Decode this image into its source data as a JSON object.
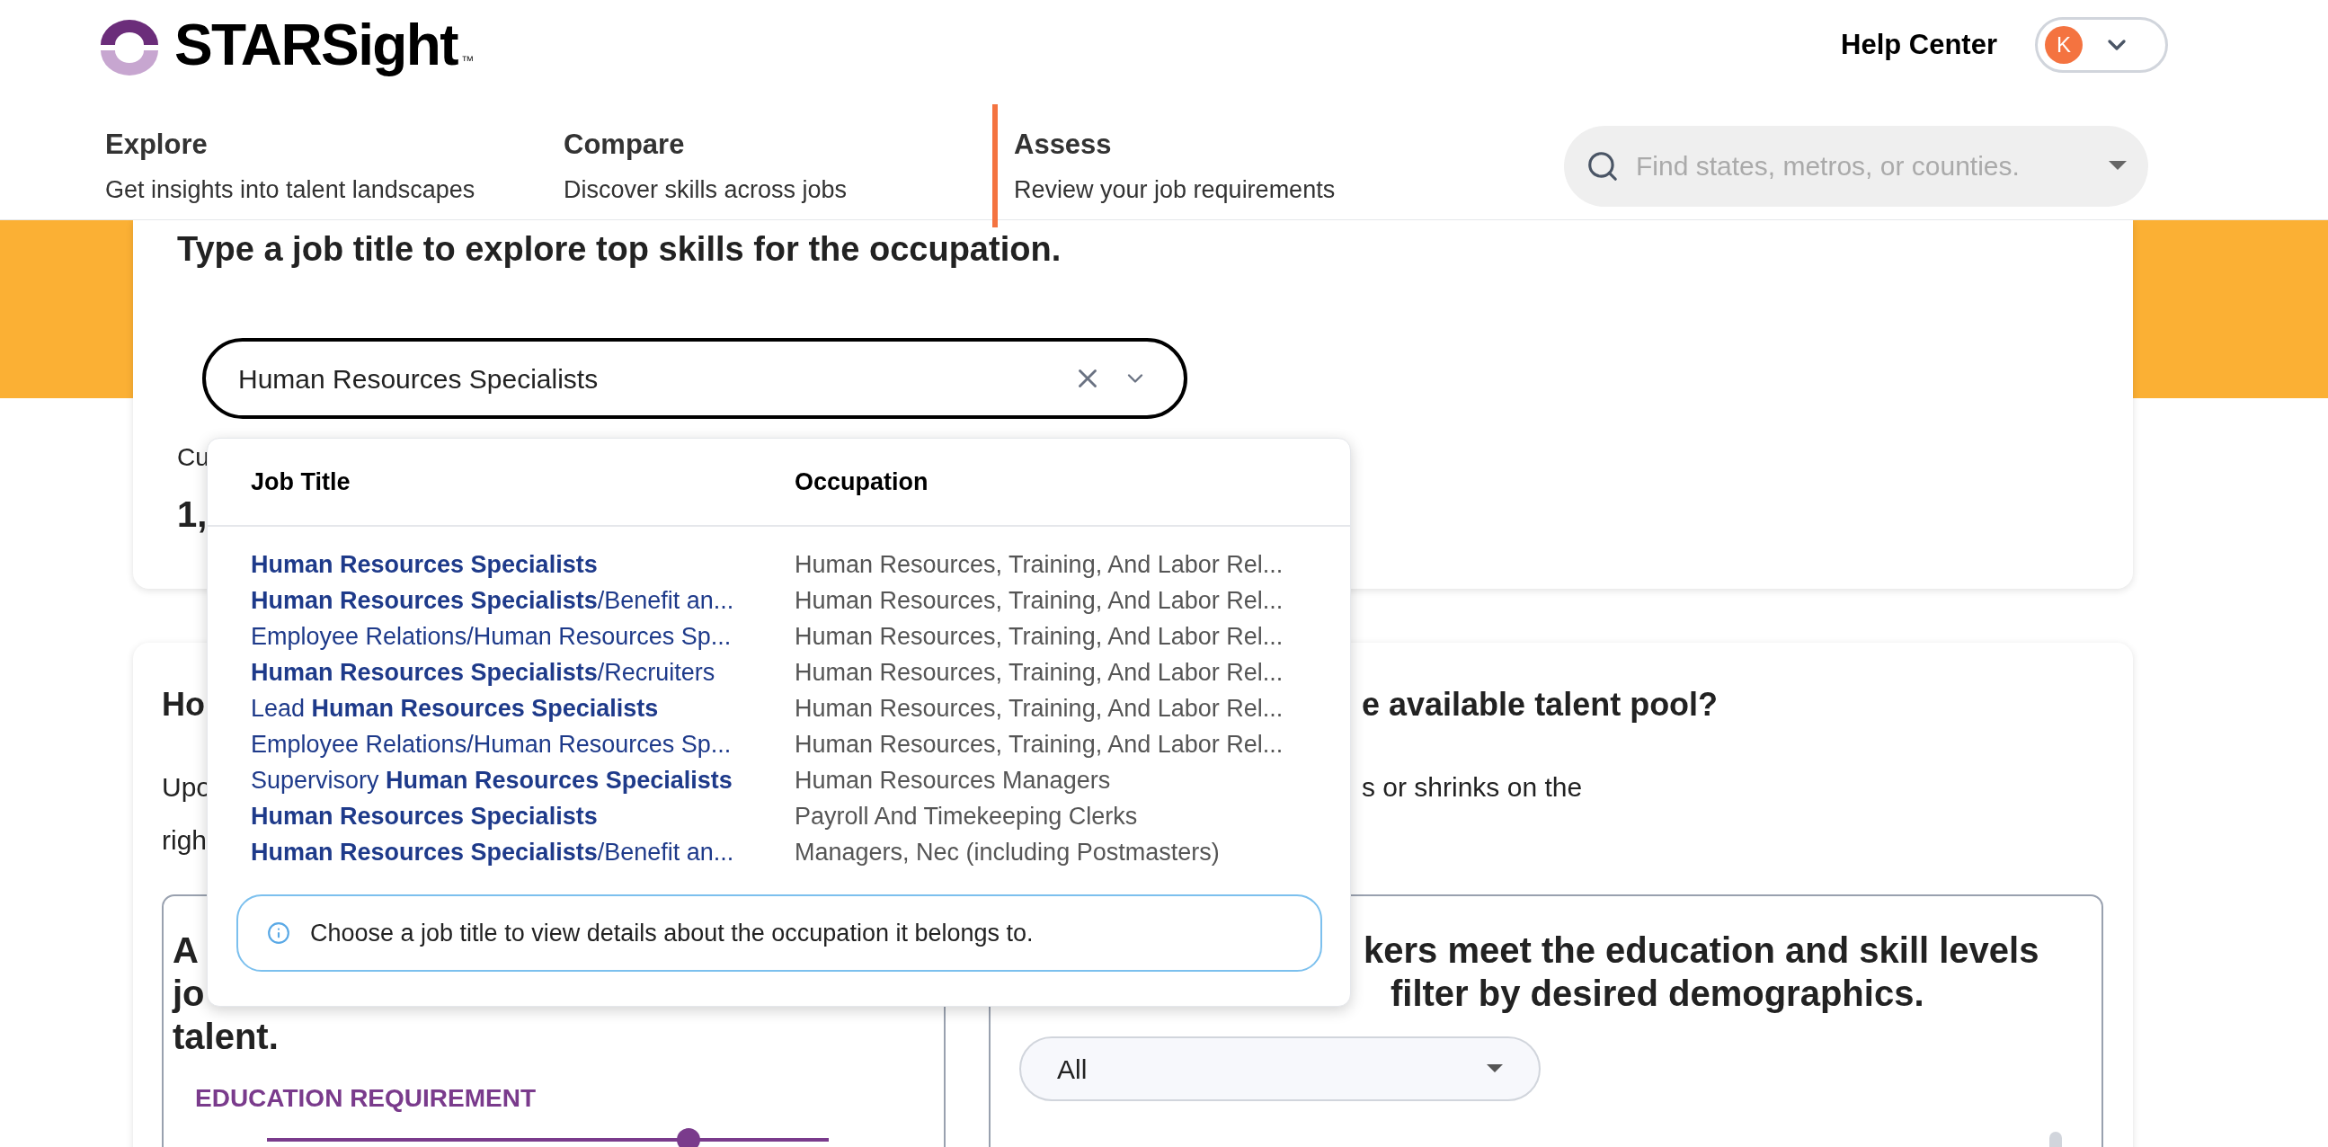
{
  "header": {
    "logo_text": "STARSight",
    "logo_mark": "™",
    "help": "Help Center",
    "avatar_initial": "K"
  },
  "nav": [
    {
      "label": "Explore",
      "sub": "Get insights into talent landscapes",
      "selected": false
    },
    {
      "label": "Compare",
      "sub": "Discover skills across jobs",
      "selected": false
    },
    {
      "label": "Assess",
      "sub": "Review your job requirements",
      "selected": true
    }
  ],
  "location_search": {
    "placeholder": "Find states, metros, or counties."
  },
  "job_card": {
    "title": "Type a job title to explore top skills for the occupation.",
    "input_value": "Human Resources Specialists",
    "label_fragment": "Cu",
    "value_fragment": "1,"
  },
  "dropdown": {
    "columns": [
      "Job Title",
      "Occupation"
    ],
    "rows": [
      {
        "title": "**Human Resources Specialists**",
        "occupation": "Human Resources, Training, And Labor Rel..."
      },
      {
        "title": "**Human Resources Specialists**/Benefit an...",
        "occupation": "Human Resources, Training, And Labor Rel..."
      },
      {
        "title": "Employee Relations/Human Resources Sp...",
        "occupation": "Human Resources, Training, And Labor Rel..."
      },
      {
        "title": "**Human Resources Specialists**/Recruiters",
        "occupation": "Human Resources, Training, And Labor Rel..."
      },
      {
        "title": "Lead **Human Resources Specialists**",
        "occupation": "Human Resources, Training, And Labor Rel..."
      },
      {
        "title": "Employee Relations/Human Resources Sp...",
        "occupation": "Human Resources, Training, And Labor Rel..."
      },
      {
        "title": "Supervisory **Human Resources Specialists**",
        "occupation": "Human Resources Managers"
      },
      {
        "title": "**Human Resources Specialists**",
        "occupation": "Payroll And Timekeeping Clerks"
      },
      {
        "title": "**Human Resources Specialists**/Benefit an...",
        "occupation": "Managers, Nec (including Postmasters)"
      }
    ],
    "info": "Choose a job title to view details about the occupation it belongs to."
  },
  "pool_card": {
    "heading_left": "Ho",
    "heading_right": "e available talent pool?",
    "text_left": [
      "Upo",
      "righ"
    ],
    "text_right": "s or shrinks on the",
    "left_panel": {
      "heading": [
        "A",
        "jo",
        "talent."
      ],
      "education_label": "EDUCATION REQUIREMENT",
      "level": 0.75
    },
    "right_panel": {
      "heading": [
        "kers meet the education and skill levels",
        "filter by desired demographics."
      ],
      "select_value": "All"
    }
  }
}
